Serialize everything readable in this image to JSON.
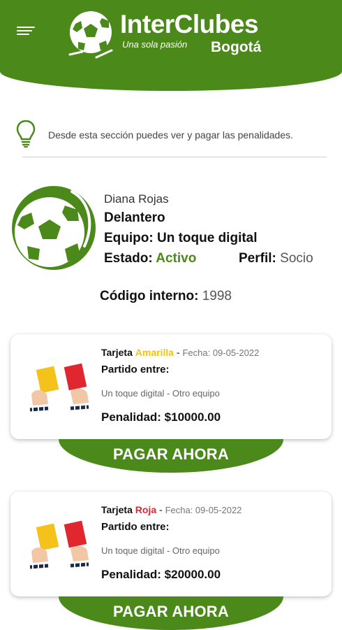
{
  "header": {
    "brand_title": "InterClubes",
    "tagline": "Una sola pasión",
    "city": "Bogotá"
  },
  "info": {
    "text": "Desde esta sección puedes ver y pagar las penalidades."
  },
  "profile": {
    "name": "Diana Rojas",
    "position": "Delantero",
    "team_label": "Equipo:",
    "team_value": "Un toque digital",
    "status_label": "Estado:",
    "status_value": "Activo",
    "profile_label": "Perfil:",
    "profile_value": "Socio",
    "code_label": "Código interno:",
    "code_value": "1998"
  },
  "penalties": [
    {
      "card_label": "Tarjeta",
      "card_color": "Amarilla",
      "date_label": "Fecha: 09-05-2022",
      "match_label": "Partido entre:",
      "match": "Un toque digital - Otro equipo",
      "amount": "Penalidad: $10000.00",
      "pay_label": "PAGAR AHORA"
    },
    {
      "card_label": "Tarjeta",
      "card_color": "Roja",
      "date_label": "Fecha: 09-05-2022",
      "match_label": "Partido entre:",
      "match": "Un toque digital - Otro equipo",
      "amount": "Penalidad: $20000.00",
      "pay_label": "PAGAR AHORA"
    }
  ],
  "colors": {
    "brand_green": "#4b8a1a",
    "yellow_card": "#f3c30d",
    "red_card": "#e0262e"
  }
}
